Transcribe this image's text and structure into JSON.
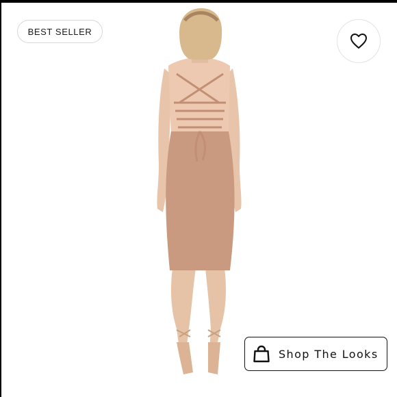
{
  "listing": {
    "badge_label": "BEST SELLER",
    "like_icon": "heart-outline-icon",
    "shop_looks_label": "Shop The Looks",
    "shop_icon": "shopping-bag-icon"
  },
  "photo": {
    "background_color": "#ffffff",
    "dress_color": "#c99a80",
    "skin_color": "#e8c6ad",
    "hair_color": "#d8b98e"
  }
}
